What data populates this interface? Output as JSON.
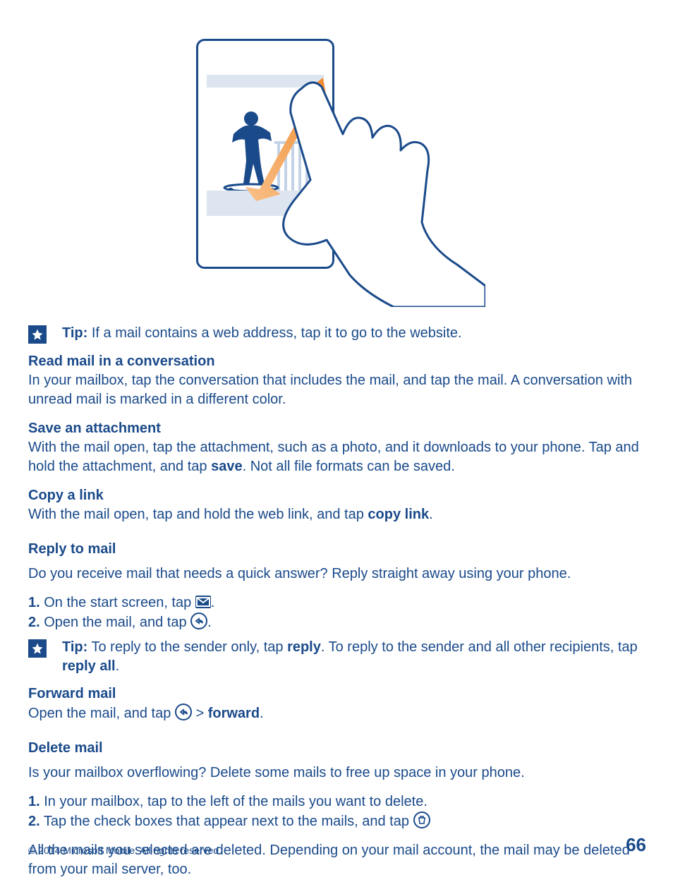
{
  "tips": {
    "tip1_label": "Tip:",
    "tip1_text": " If a mail contains a web address, tap it to go to the website.",
    "tip2_label": "Tip:",
    "tip2_a": " To reply to the sender only, tap ",
    "tip2_reply": "reply",
    "tip2_b": ". To reply to the sender and all other recipients, tap ",
    "tip2_replyall": "reply all",
    "tip2_c": "."
  },
  "read_conv": {
    "heading": "Read mail in a conversation",
    "body": "In your mailbox, tap the conversation that includes the mail, and tap the mail. A conversation with unread mail is marked in a different color."
  },
  "save_attach": {
    "heading": "Save an attachment",
    "body_a": "With the mail open, tap the attachment, such as a photo, and it downloads to your phone. Tap and hold the attachment, and tap ",
    "save": "save",
    "body_b": ". Not all file formats can be saved."
  },
  "copy_link": {
    "heading": "Copy a link",
    "body_a": "With the mail open, tap and hold the web link, and tap ",
    "copy": "copy link",
    "body_b": "."
  },
  "reply": {
    "heading": "Reply to mail",
    "intro": "Do you receive mail that needs a quick answer? Reply straight away using your phone.",
    "step1_num": "1.",
    "step1_text": " On the start screen, tap ",
    "step1_dot": ".",
    "step2_num": "2.",
    "step2_text": " Open the mail, and tap ",
    "step2_dot": "."
  },
  "forward": {
    "heading": "Forward mail",
    "body_a": "Open the mail, and tap ",
    "gt": " > ",
    "fwd": "forward",
    "body_b": "."
  },
  "delete": {
    "heading": "Delete mail",
    "intro": "Is your mailbox overflowing? Delete some mails to free up space in your phone.",
    "step1_num": "1.",
    "step1_text": " In your mailbox, tap to the left of the mails you want to delete.",
    "step2_num": "2.",
    "step2_text": " Tap the check boxes that appear next to the mails, and tap ",
    "outro": "All the mails you selected are deleted. Depending on your mail account, the mail may be deleted from your mail server, too."
  },
  "footer": {
    "copyright": "© 2014 Microsoft Mobile. All rights reserved.",
    "page": "66"
  }
}
